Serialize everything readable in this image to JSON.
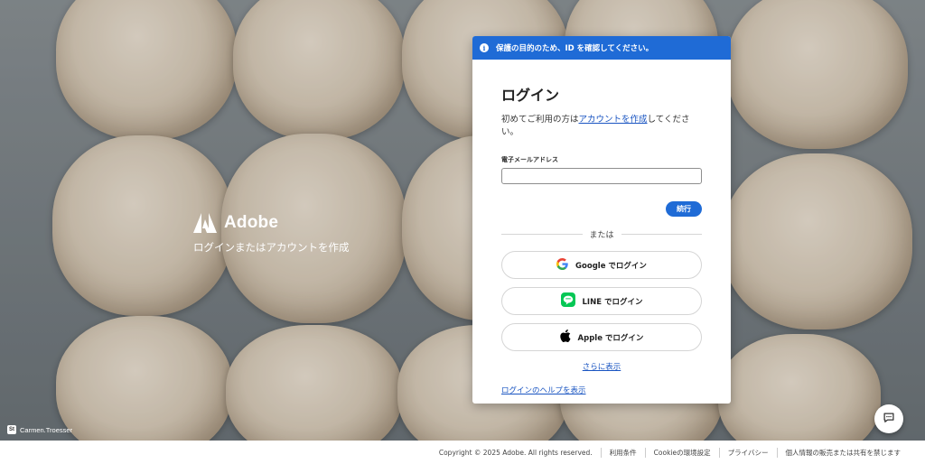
{
  "brand": {
    "name": "Adobe",
    "tagline": "ログインまたはアカウントを作成"
  },
  "photo_credit": {
    "badge": "St",
    "name": "Carmen.Troesser"
  },
  "banner": {
    "icon": "info-icon",
    "text": "保護の目的のため、ID を確認してください。"
  },
  "login": {
    "title": "ログイン",
    "subtitle_prefix": "初めてご利用の方は",
    "subtitle_link": "アカウントを作成",
    "subtitle_suffix": "してください。",
    "email_label": "電子メールアドレス",
    "email_value": "",
    "continue_label": "続行",
    "or_label": "または",
    "google_label": "Google でログイン",
    "line_label": "LINE でログイン",
    "apple_label": "Apple でログイン",
    "more_label": "さらに表示",
    "help_label": "ログインのヘルプを表示"
  },
  "chat": {
    "icon": "chat-icon"
  },
  "footer": {
    "copyright": "Copyright © 2025 Adobe. All rights reserved.",
    "terms": "利用条件",
    "cookie": "Cookieの環境設定",
    "privacy": "プライバシー",
    "no_sell": "個人情報の販売または共有を禁じます"
  },
  "colors": {
    "accent": "#1f6bd6",
    "link": "#1a55c2"
  }
}
